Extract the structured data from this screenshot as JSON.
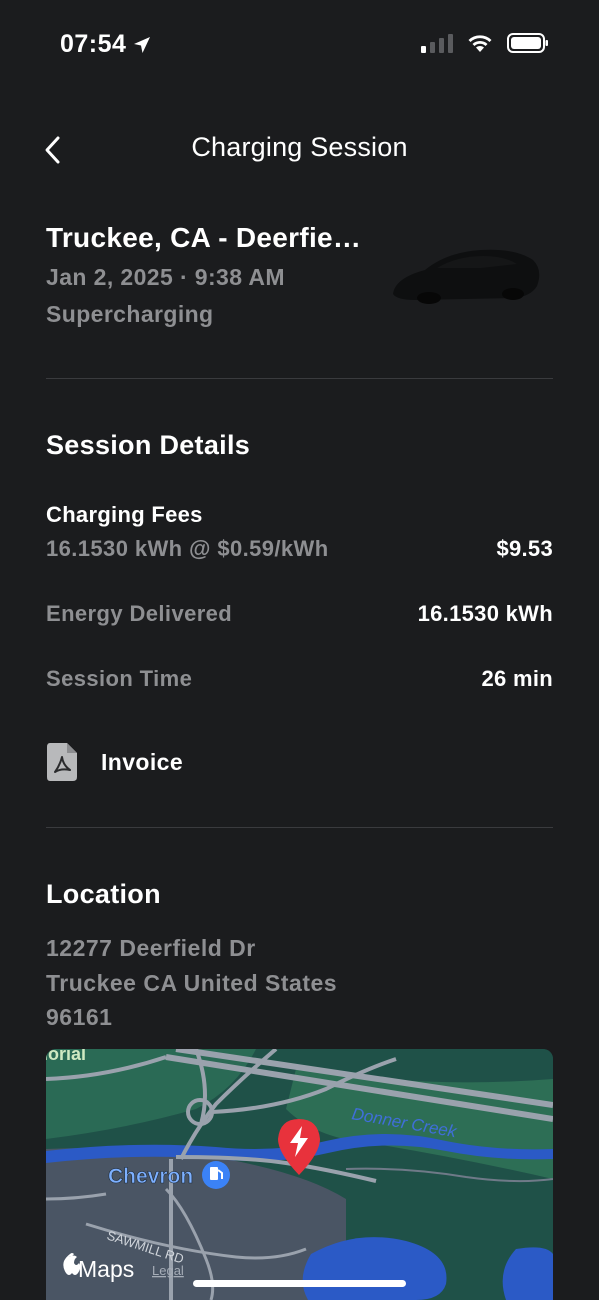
{
  "status_bar": {
    "time": "07:54"
  },
  "nav": {
    "title": "Charging Session"
  },
  "session": {
    "location": "Truckee, CA - Deerfie…",
    "date": "Jan 2, 2025 · 9:38 AM",
    "type": "Supercharging"
  },
  "details": {
    "title": "Session Details",
    "fees_label": "Charging Fees",
    "fees_rate": "16.1530 kWh @ $0.59/kWh",
    "fees_value": "$9.53",
    "energy_label": "Energy Delivered",
    "energy_value": "16.1530 kWh",
    "time_label": "Session Time",
    "time_value": "26 min",
    "invoice_label": "Invoice"
  },
  "location": {
    "title": "Location",
    "address_line1": "12277 Deerfield Dr",
    "address_line2": "Truckee CA United States",
    "address_line3": "96161"
  },
  "map": {
    "label_memorial": "lorial",
    "label_creek": "Donner Creek",
    "label_chevron": "Chevron",
    "label_road": "SAWMILL RD",
    "attribution": "Maps",
    "legal": "Legal"
  },
  "colors": {
    "background": "#1b1c1e",
    "secondary_text": "#8e8f92",
    "pin": "#e8323c"
  }
}
